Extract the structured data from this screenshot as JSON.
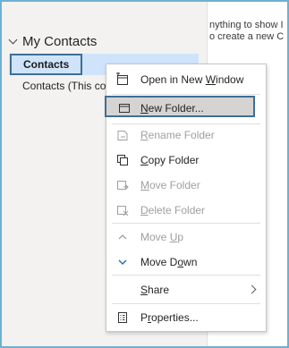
{
  "main": {
    "hint_line1": "nything to show I",
    "hint_line2": "o create a new C"
  },
  "sidebar": {
    "group_label": "My Contacts",
    "selected_item": "Contacts",
    "other_item": "Contacts (This co"
  },
  "context_menu": {
    "items": [
      {
        "pre": "Open in New ",
        "key": "W",
        "post": "indow",
        "icon": "open-window-icon",
        "enabled": true
      },
      {
        "pre": "",
        "key": "N",
        "post": "ew Folder...",
        "icon": "new-folder-icon",
        "enabled": true,
        "highlighted": true
      },
      {
        "pre": "",
        "key": "R",
        "post": "ename Folder",
        "icon": "rename-folder-icon",
        "enabled": false
      },
      {
        "pre": "",
        "key": "C",
        "post": "opy Folder",
        "icon": "copy-folder-icon",
        "enabled": true
      },
      {
        "pre": "",
        "key": "M",
        "post": "ove Folder",
        "icon": "move-folder-icon",
        "enabled": false
      },
      {
        "pre": "",
        "key": "D",
        "post": "elete Folder",
        "icon": "delete-folder-icon",
        "enabled": false
      },
      {
        "pre": "Move ",
        "key": "U",
        "post": "p",
        "icon": "move-up-icon",
        "enabled": false
      },
      {
        "pre": "Move D",
        "key": "o",
        "post": "wn",
        "icon": "move-down-icon",
        "enabled": true
      },
      {
        "pre": "",
        "key": "S",
        "post": "hare",
        "icon": "chevron-right-icon",
        "enabled": true
      },
      {
        "pre": "P",
        "key": "r",
        "post": "operties...",
        "icon": "properties-icon",
        "enabled": true
      }
    ]
  },
  "colors": {
    "accent": "#3e6f95",
    "selection": "#cfe4fa",
    "disabled": "#a19f9d",
    "frame": "#6fb0cf"
  }
}
